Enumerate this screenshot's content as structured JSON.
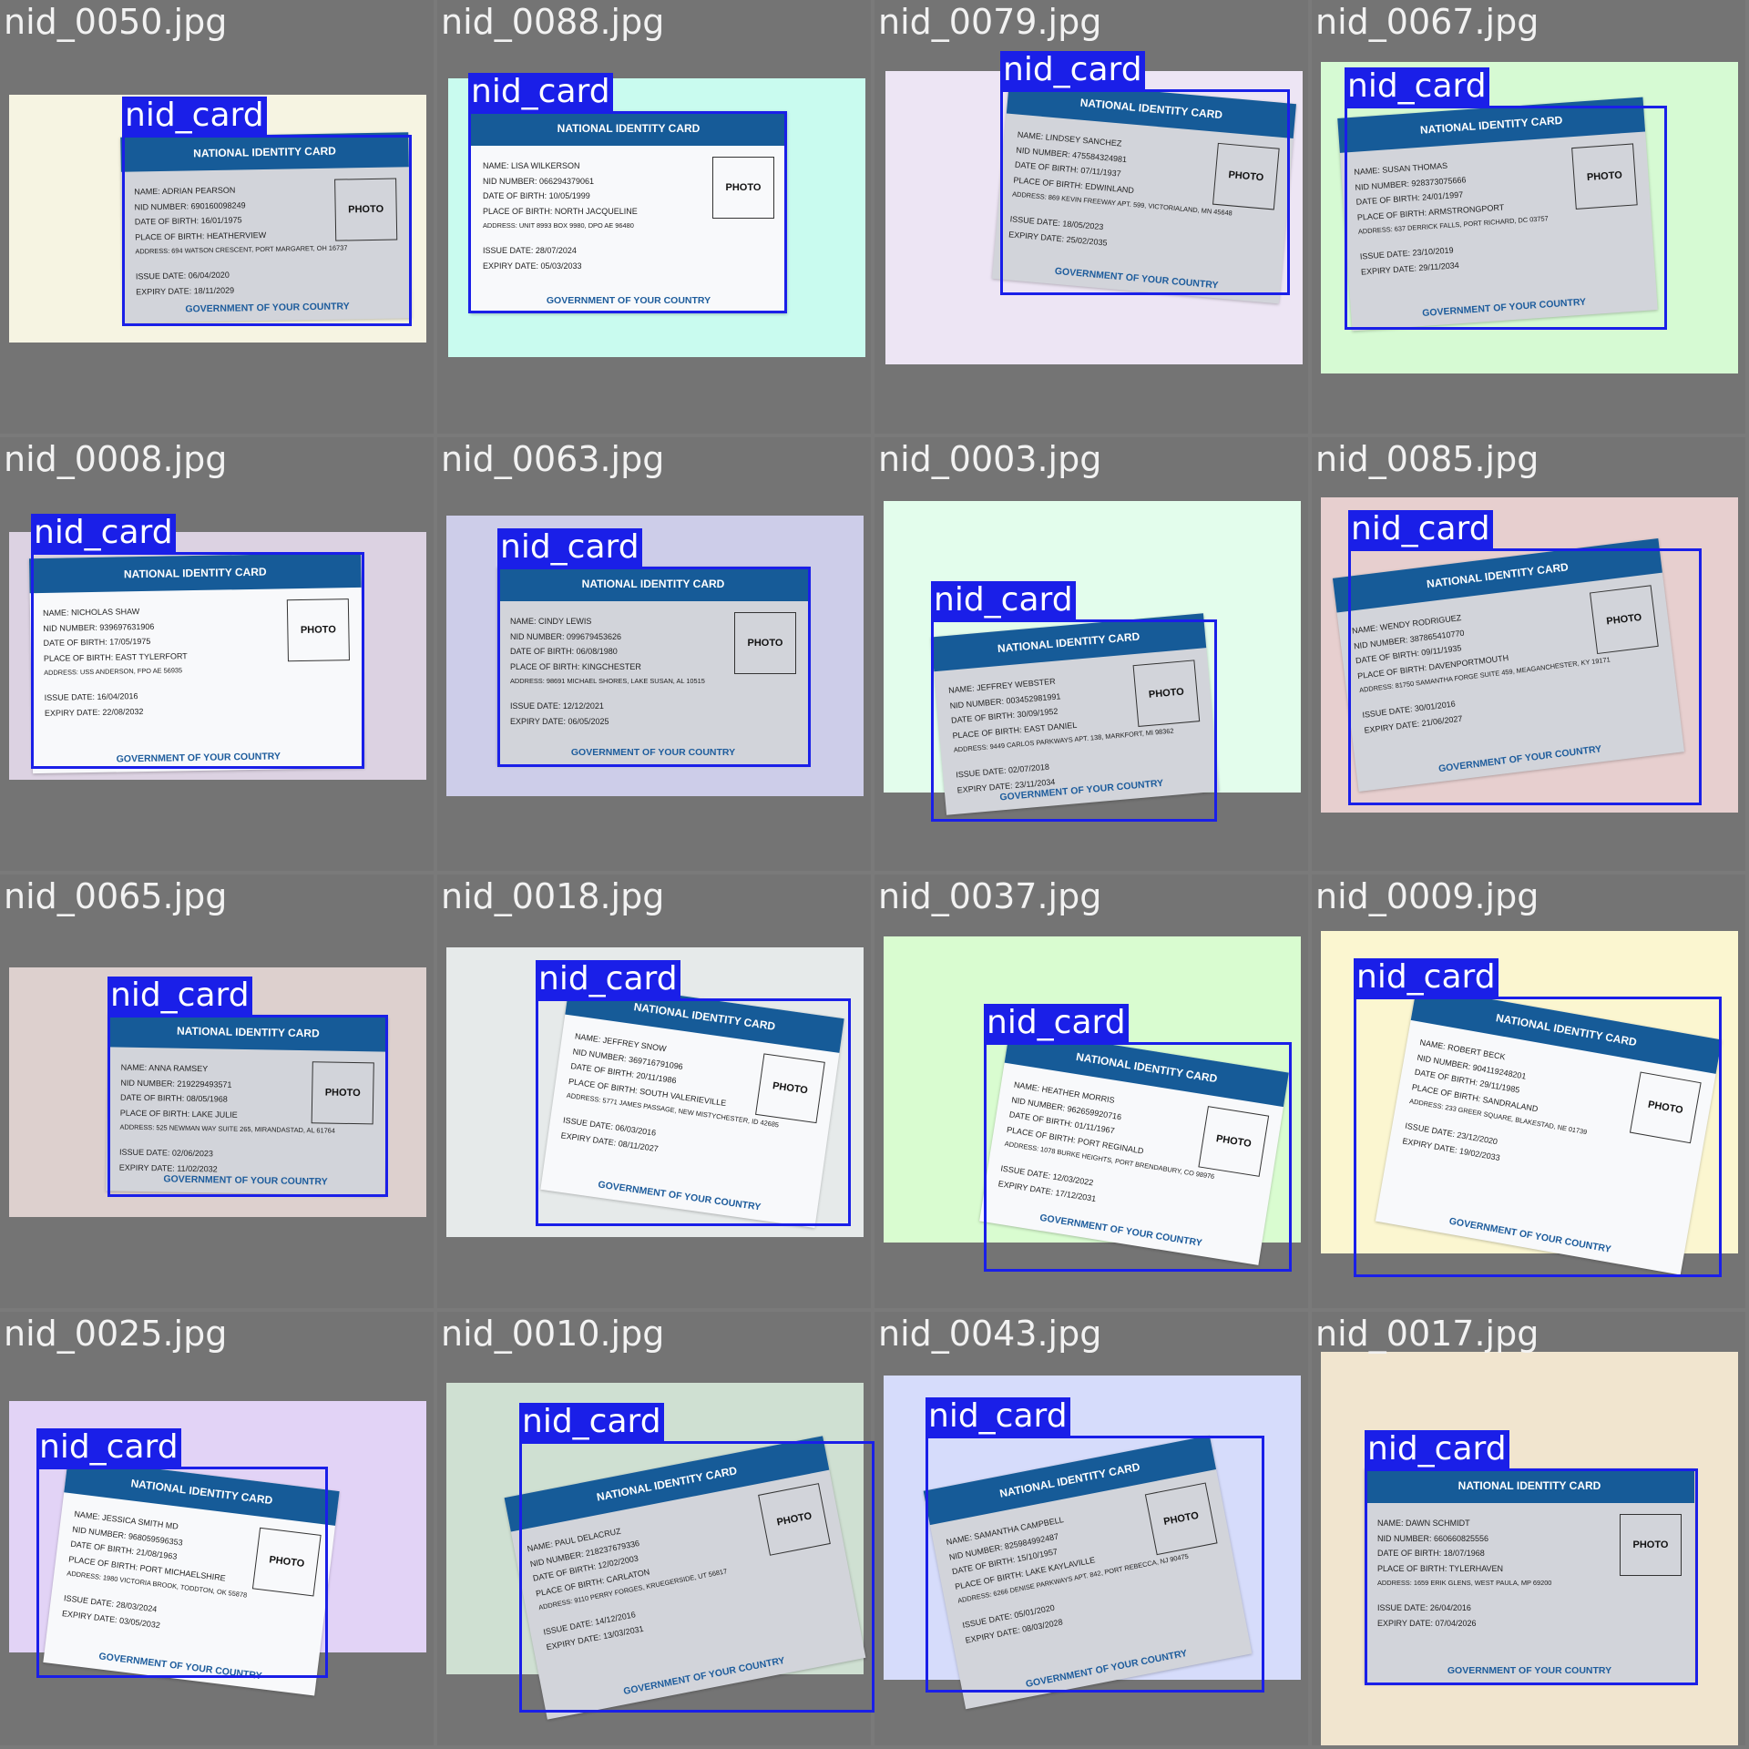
{
  "card_text": {
    "header": "NATIONAL IDENTITY CARD",
    "photo": "PHOTO",
    "footer": "GOVERNMENT OF YOUR COUNTRY"
  },
  "colors": {
    "box": "#1a1fe8",
    "card_header": "#165b98",
    "tile_background": "#747474"
  },
  "tiles": [
    {
      "filename": "nid_0050.jpg",
      "detection_label": "nid_card",
      "bg_color": "#f6f4e2",
      "card": {
        "name": "NAME: ADRIAN PEARSON",
        "nid": "NID NUMBER: 690160098249",
        "dob": "DATE OF BIRTH: 16/01/1975",
        "pob": "PLACE OF BIRTH: HEATHERVIEW",
        "address": "ADDRESS: 694 WATSON CRESCENT, PORT MARGARET, OH 16737",
        "issue": "ISSUE DATE: 06/04/2020",
        "expiry": "EXPIRY DATE: 18/11/2029"
      }
    },
    {
      "filename": "nid_0088.jpg",
      "detection_label": "nid_card",
      "bg_color": "#c9fbef",
      "card": {
        "name": "NAME: LISA WILKERSON",
        "nid": "NID NUMBER: 066294379061",
        "dob": "DATE OF BIRTH: 10/05/1999",
        "pob": "PLACE OF BIRTH: NORTH JACQUELINE",
        "address": "ADDRESS: UNIT 8993 BOX 9980, DPO AE 96480",
        "issue": "ISSUE DATE: 28/07/2024",
        "expiry": "EXPIRY DATE: 05/03/2033"
      }
    },
    {
      "filename": "nid_0079.jpg",
      "detection_label": "nid_card",
      "bg_color": "#ede5f4",
      "card": {
        "name": "NAME: LINDSEY SANCHEZ",
        "nid": "NID NUMBER: 475584324981",
        "dob": "DATE OF BIRTH: 07/11/1937",
        "pob": "PLACE OF BIRTH: EDWINLAND",
        "address": "ADDRESS: 869 KEVIN FREEWAY APT. 599, VICTORIALAND, MN 45648",
        "issue": "ISSUE DATE: 18/05/2023",
        "expiry": "EXPIRY DATE: 25/02/2035"
      }
    },
    {
      "filename": "nid_0067.jpg",
      "detection_label": "nid_card",
      "bg_color": "#d6fad3",
      "card": {
        "name": "NAME: SUSAN THOMAS",
        "nid": "NID NUMBER: 928373075666",
        "dob": "DATE OF BIRTH: 24/01/1997",
        "pob": "PLACE OF BIRTH: ARMSTRONGPORT",
        "address": "ADDRESS: 637 DERRICK FALLS, PORT RICHARD, DC 03757",
        "issue": "ISSUE DATE: 23/10/2019",
        "expiry": "EXPIRY DATE: 29/11/2034"
      }
    },
    {
      "filename": "nid_0008.jpg",
      "detection_label": "nid_card",
      "bg_color": "#dcd2e2",
      "card": {
        "name": "NAME: NICHOLAS SHAW",
        "nid": "NID NUMBER: 939697631906",
        "dob": "DATE OF BIRTH: 17/05/1975",
        "pob": "PLACE OF BIRTH: EAST TYLERFORT",
        "address": "ADDRESS: USS ANDERSON, FPO AE 56935",
        "issue": "ISSUE DATE: 16/04/2016",
        "expiry": "EXPIRY DATE: 22/08/2032"
      }
    },
    {
      "filename": "nid_0063.jpg",
      "detection_label": "nid_card",
      "bg_color": "#cdcde9",
      "card": {
        "name": "NAME: CINDY LEWIS",
        "nid": "NID NUMBER: 099679453626",
        "dob": "DATE OF BIRTH: 06/08/1980",
        "pob": "PLACE OF BIRTH: KINGCHESTER",
        "address": "ADDRESS: 98691 MICHAEL SHORES, LAKE SUSAN, AL 10515",
        "issue": "ISSUE DATE: 12/12/2021",
        "expiry": "EXPIRY DATE: 06/05/2025"
      }
    },
    {
      "filename": "nid_0003.jpg",
      "detection_label": "nid_card",
      "bg_color": "#e3fdec",
      "card": {
        "name": "NAME: JEFFREY WEBSTER",
        "nid": "NID NUMBER: 003452981991",
        "dob": "DATE OF BIRTH: 30/09/1952",
        "pob": "PLACE OF BIRTH: EAST DANIEL",
        "address": "ADDRESS: 9449 CARLOS PARKWAYS APT. 138, MARKFORT, MI 98362",
        "issue": "ISSUE DATE: 02/07/2018",
        "expiry": "EXPIRY DATE: 23/11/2034"
      }
    },
    {
      "filename": "nid_0085.jpg",
      "detection_label": "nid_card",
      "bg_color": "#e7cfcf",
      "card": {
        "name": "NAME: WENDY RODRIGUEZ",
        "nid": "NID NUMBER: 387865410770",
        "dob": "DATE OF BIRTH: 09/11/1935",
        "pob": "PLACE OF BIRTH: DAVENPORTMOUTH",
        "address": "ADDRESS: 81750 SAMANTHA FORGE SUITE 459, MEAGANCHESTER, KY 19171",
        "issue": "ISSUE DATE: 30/01/2016",
        "expiry": "EXPIRY DATE: 21/06/2027"
      }
    },
    {
      "filename": "nid_0065.jpg",
      "detection_label": "nid_card",
      "bg_color": "#ddd0ce",
      "card": {
        "name": "NAME: ANNA RAMSEY",
        "nid": "NID NUMBER: 219229493571",
        "dob": "DATE OF BIRTH: 08/05/1968",
        "pob": "PLACE OF BIRTH: LAKE JULIE",
        "address": "ADDRESS: 525 NEWMAN WAY SUITE 265, MIRANDASTAD, AL 61764",
        "issue": "ISSUE DATE: 02/06/2023",
        "expiry": "EXPIRY DATE: 11/02/2032"
      }
    },
    {
      "filename": "nid_0018.jpg",
      "detection_label": "nid_card",
      "bg_color": "#e6eaea",
      "card": {
        "name": "NAME: JEFFREY SNOW",
        "nid": "NID NUMBER: 369716791096",
        "dob": "DATE OF BIRTH: 20/11/1986",
        "pob": "PLACE OF BIRTH: SOUTH VALERIEVILLE",
        "address": "ADDRESS: 5771 JAMES PASSAGE, NEW MISTYCHESTER, ID 42685",
        "issue": "ISSUE DATE: 06/03/2016",
        "expiry": "EXPIRY DATE: 08/11/2027"
      }
    },
    {
      "filename": "nid_0037.jpg",
      "detection_label": "nid_card",
      "bg_color": "#d9fcd0",
      "card": {
        "name": "NAME: HEATHER MORRIS",
        "nid": "NID NUMBER: 962659920716",
        "dob": "DATE OF BIRTH: 01/11/1967",
        "pob": "PLACE OF BIRTH: PORT REGINALD",
        "address": "ADDRESS: 1078 BURKE HEIGHTS, PORT BRENDABURY, CO 98976",
        "issue": "ISSUE DATE: 12/03/2022",
        "expiry": "EXPIRY DATE: 17/12/2031"
      }
    },
    {
      "filename": "nid_0009.jpg",
      "detection_label": "nid_card",
      "bg_color": "#fbf6d0",
      "card": {
        "name": "NAME: ROBERT BECK",
        "nid": "NID NUMBER: 904119248201",
        "dob": "DATE OF BIRTH: 29/11/1985",
        "pob": "PLACE OF BIRTH: SANDRALAND",
        "address": "ADDRESS: 233 GREER SQUARE, BLAKESTAD, NE 01739",
        "issue": "ISSUE DATE: 23/12/2020",
        "expiry": "EXPIRY DATE: 19/02/2033"
      }
    },
    {
      "filename": "nid_0025.jpg",
      "detection_label": "nid_card",
      "bg_color": "#e2d3f6",
      "card": {
        "name": "NAME: JESSICA SMITH MD",
        "nid": "NID NUMBER: 968059596353",
        "dob": "DATE OF BIRTH: 21/08/1963",
        "pob": "PLACE OF BIRTH: PORT MICHAELSHIRE",
        "address": "ADDRESS: 1980 VICTORIA BROOK, TODDTON, OK 55878",
        "issue": "ISSUE DATE: 28/03/2024",
        "expiry": "EXPIRY DATE: 03/05/2032"
      }
    },
    {
      "filename": "nid_0010.jpg",
      "detection_label": "nid_card",
      "bg_color": "#cfe0d2",
      "card": {
        "name": "NAME: PAUL DELACRUZ",
        "nid": "NID NUMBER: 218237679336",
        "dob": "DATE OF BIRTH: 12/02/2003",
        "pob": "PLACE OF BIRTH: CARLATON",
        "address": "ADDRESS: 9110 PERRY FORGES, KRUEGERSIDE, UT 56817",
        "issue": "ISSUE DATE: 14/12/2016",
        "expiry": "EXPIRY DATE: 13/03/2031"
      }
    },
    {
      "filename": "nid_0043.jpg",
      "detection_label": "nid_card",
      "bg_color": "#d6dcfb",
      "card": {
        "name": "NAME: SAMANTHA CAMPBELL",
        "nid": "NID NUMBER: 825984992487",
        "dob": "DATE OF BIRTH: 15/10/1957",
        "pob": "PLACE OF BIRTH: LAKE KAYLAVILLE",
        "address": "ADDRESS: 6266 DENISE PARKWAYS APT. 842, PORT REBECCA, NJ 90475",
        "issue": "ISSUE DATE: 05/01/2020",
        "expiry": "EXPIRY DATE: 08/03/2028"
      }
    },
    {
      "filename": "nid_0017.jpg",
      "detection_label": "nid_card",
      "bg_color": "#f1e5cf",
      "card": {
        "name": "NAME: DAWN SCHMIDT",
        "nid": "NID NUMBER: 660660825556",
        "dob": "DATE OF BIRTH: 18/07/1968",
        "pob": "PLACE OF BIRTH: TYLERHAVEN",
        "address": "ADDRESS: 1659 ERIK GLENS, WEST PAULA, MP 69200",
        "issue": "ISSUE DATE: 26/04/2016",
        "expiry": "EXPIRY DATE: 07/04/2026"
      }
    }
  ]
}
